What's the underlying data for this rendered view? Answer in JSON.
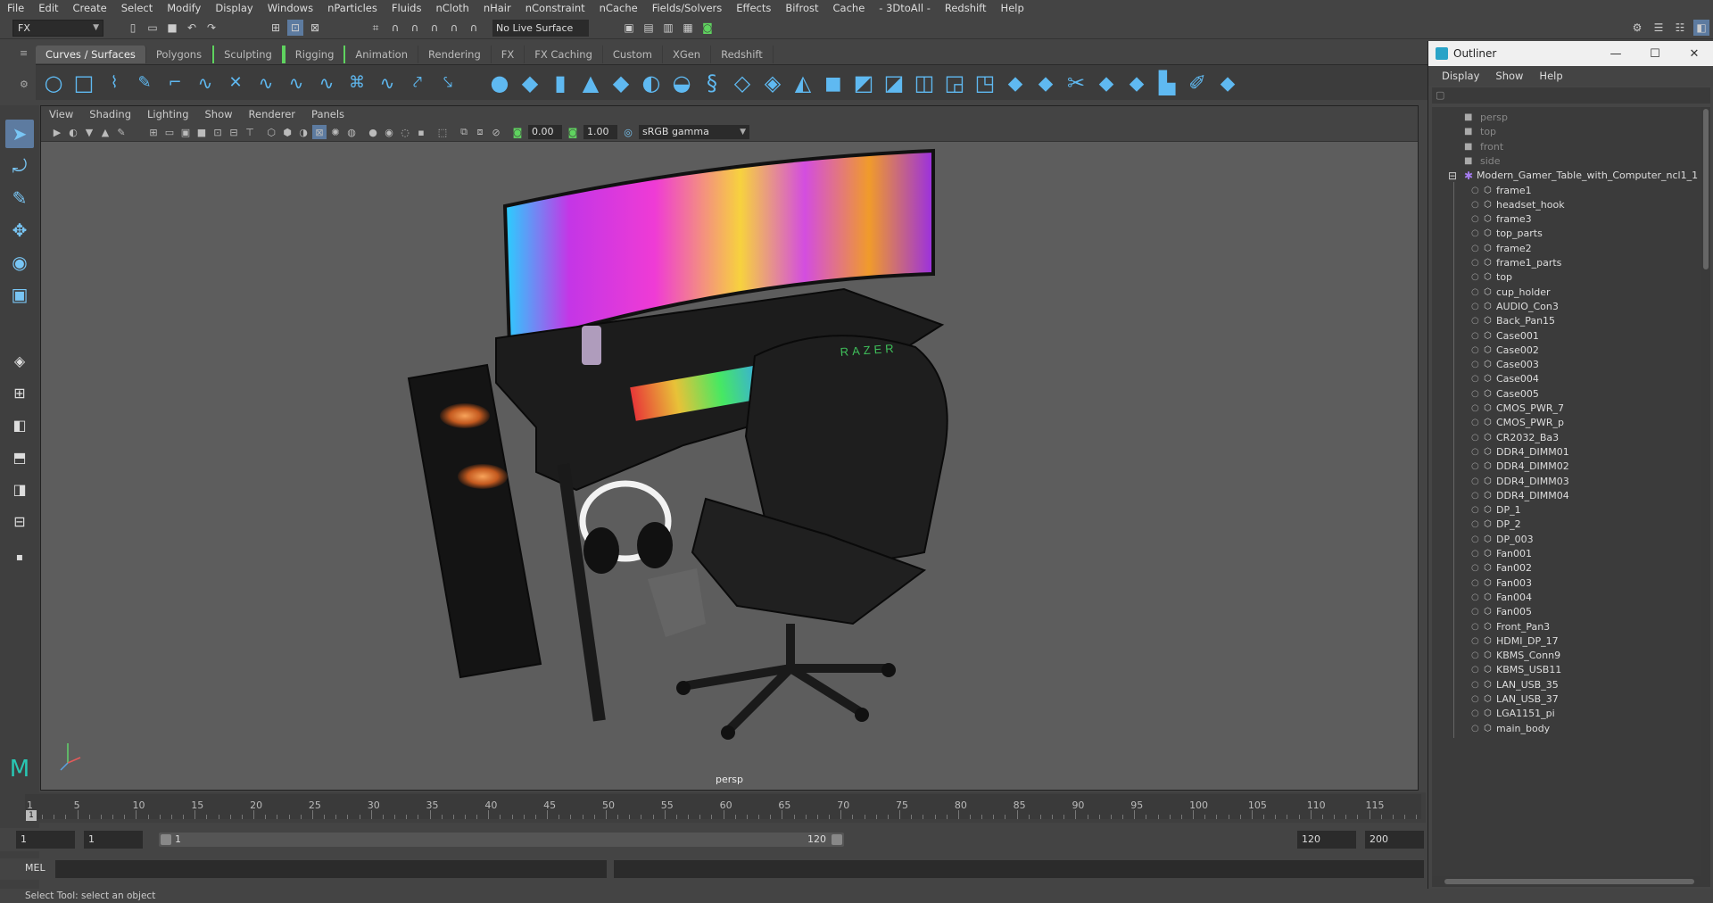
{
  "menubar": [
    "File",
    "Edit",
    "Create",
    "Select",
    "Modify",
    "Display",
    "Windows",
    "nParticles",
    "Fluids",
    "nCloth",
    "nHair",
    "nConstraint",
    "nCache",
    "Fields/Solvers",
    "Effects",
    "Bifrost",
    "Cache",
    "- 3DtoAll -",
    "Redshift",
    "Help"
  ],
  "status": {
    "mode": "FX",
    "live_surface": "No Live Surface"
  },
  "shelf_tabs": [
    "Curves / Surfaces",
    "Polygons",
    "Sculpting",
    "Rigging",
    "Animation",
    "Rendering",
    "FX",
    "FX Caching",
    "Custom",
    "XGen",
    "Redshift"
  ],
  "viewport": {
    "menu": [
      "View",
      "Shading",
      "Lighting",
      "Show",
      "Renderer",
      "Panels"
    ],
    "exposure": "0.00",
    "gamma": "1.00",
    "color_space": "sRGB gamma",
    "camera": "persp",
    "brand_text": "RAZER"
  },
  "timeline": {
    "ticks": [
      "1",
      "5",
      "10",
      "15",
      "20",
      "25",
      "30",
      "35",
      "40",
      "45",
      "50",
      "55",
      "60",
      "65",
      "70",
      "75",
      "80",
      "85",
      "90",
      "95",
      "100",
      "105",
      "110",
      "115"
    ],
    "current": "1"
  },
  "range": {
    "start": "1",
    "playback_start": "1",
    "range_start": "1",
    "range_end": "120",
    "playback_end": "120",
    "end": "200"
  },
  "cmdline": {
    "label": "MEL"
  },
  "helpline": "Select Tool: select an object",
  "outliner": {
    "title": "Outliner",
    "menu": [
      "Display",
      "Show",
      "Help"
    ],
    "cameras": [
      "persp",
      "top",
      "front",
      "side"
    ],
    "group": "Modern_Gamer_Table_with_Computer_ncl1_1",
    "items": [
      "frame1",
      "headset_hook",
      "frame3",
      "top_parts",
      "frame2",
      "frame1_parts",
      "top",
      "cup_holder",
      "AUDIO_Con3",
      "Back_Pan15",
      "Case001",
      "Case002",
      "Case003",
      "Case004",
      "Case005",
      "CMOS_PWR_7",
      "CMOS_PWR_p",
      "CR2032_Ba3",
      "DDR4_DIMM01",
      "DDR4_DIMM02",
      "DDR4_DIMM03",
      "DDR4_DIMM04",
      "DP_1",
      "DP_2",
      "DP_003",
      "Fan001",
      "Fan002",
      "Fan003",
      "Fan004",
      "Fan005",
      "Front_Pan3",
      "HDMI_DP_17",
      "KBMS_Conn9",
      "KBMS_USB11",
      "LAN_USB_35",
      "LAN_USB_37",
      "LGA1151_pi",
      "main_body"
    ]
  },
  "colors": {
    "accent": "#5fb9f1",
    "active_tool": "#5d7ba0",
    "viewport_bg": "#5d5d5d"
  }
}
